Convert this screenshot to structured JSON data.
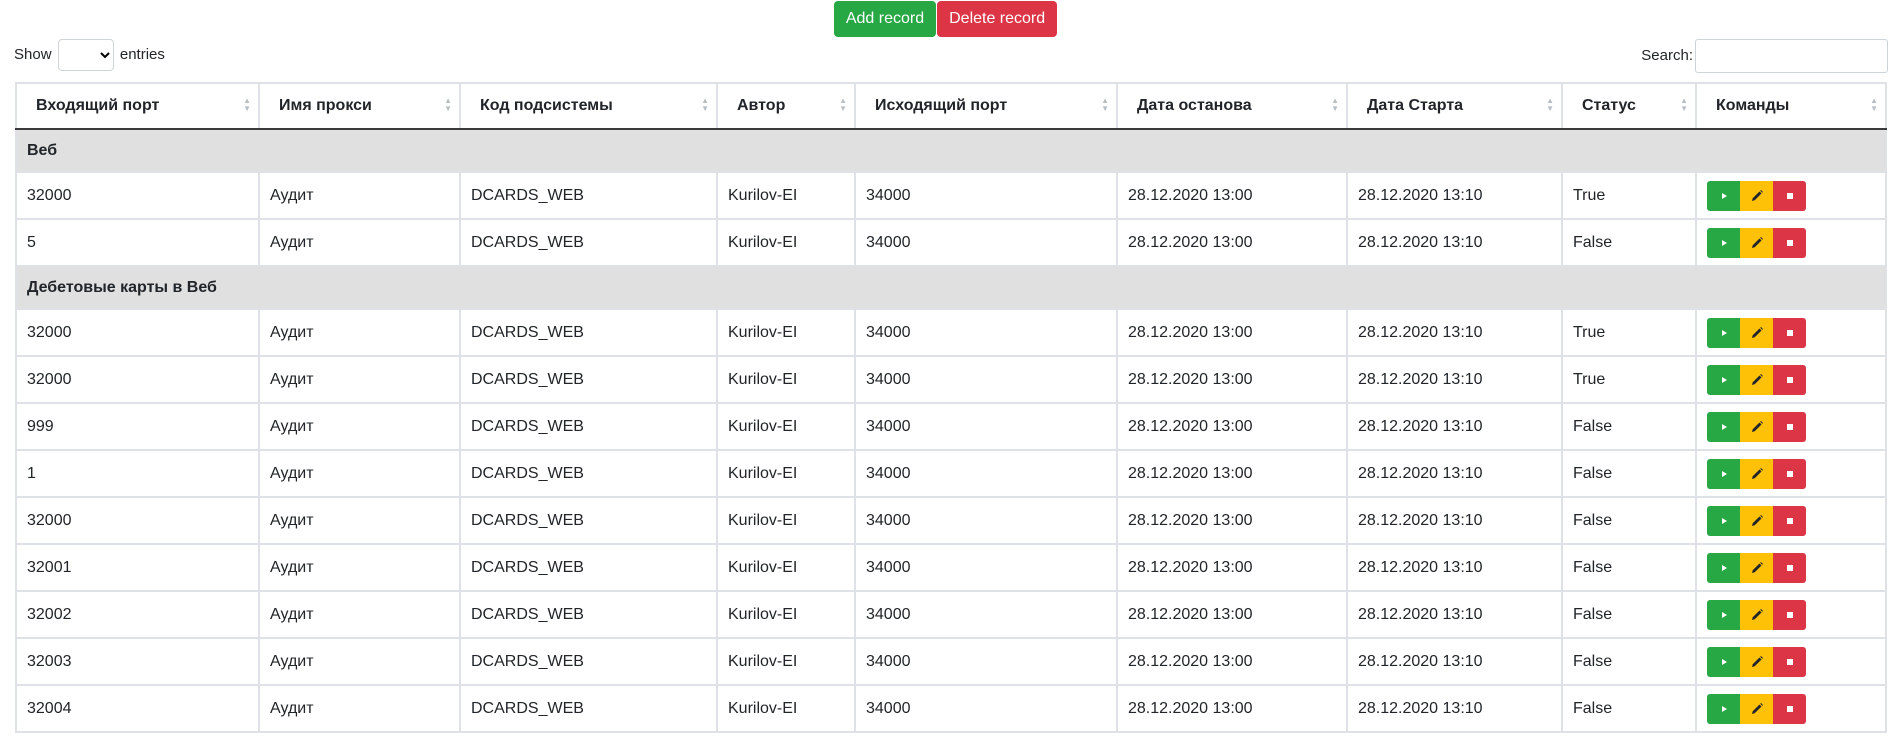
{
  "toolbar": {
    "add_label": "Add record",
    "delete_label": "Delete record"
  },
  "length": {
    "show": "Show",
    "entries": "entries",
    "value": ""
  },
  "search": {
    "label": "Search:",
    "value": ""
  },
  "columns": [
    "Входящий порт",
    "Имя прокси",
    "Код подсистемы",
    "Автор",
    "Исходящий порт",
    "Дата останова",
    "Дата Старта",
    "Статус",
    "Команды"
  ],
  "groups": [
    {
      "name": "Веб",
      "rows": [
        [
          "32000",
          "Аудит",
          "DCARDS_WEB",
          "Kurilov-EI",
          "34000",
          "28.12.2020 13:00",
          "28.12.2020 13:10",
          "True"
        ],
        [
          "5",
          "Аудит",
          "DCARDS_WEB",
          "Kurilov-EI",
          "34000",
          "28.12.2020 13:00",
          "28.12.2020 13:10",
          "False"
        ]
      ]
    },
    {
      "name": "Дебетовые карты в Веб",
      "rows": [
        [
          "32000",
          "Аудит",
          "DCARDS_WEB",
          "Kurilov-EI",
          "34000",
          "28.12.2020 13:00",
          "28.12.2020 13:10",
          "True"
        ],
        [
          "32000",
          "Аудит",
          "DCARDS_WEB",
          "Kurilov-EI",
          "34000",
          "28.12.2020 13:00",
          "28.12.2020 13:10",
          "True"
        ],
        [
          "999",
          "Аудит",
          "DCARDS_WEB",
          "Kurilov-EI",
          "34000",
          "28.12.2020 13:00",
          "28.12.2020 13:10",
          "False"
        ],
        [
          "1",
          "Аудит",
          "DCARDS_WEB",
          "Kurilov-EI",
          "34000",
          "28.12.2020 13:00",
          "28.12.2020 13:10",
          "False"
        ],
        [
          "32000",
          "Аудит",
          "DCARDS_WEB",
          "Kurilov-EI",
          "34000",
          "28.12.2020 13:00",
          "28.12.2020 13:10",
          "False"
        ],
        [
          "32001",
          "Аудит",
          "DCARDS_WEB",
          "Kurilov-EI",
          "34000",
          "28.12.2020 13:00",
          "28.12.2020 13:10",
          "False"
        ],
        [
          "32002",
          "Аудит",
          "DCARDS_WEB",
          "Kurilov-EI",
          "34000",
          "28.12.2020 13:00",
          "28.12.2020 13:10",
          "False"
        ],
        [
          "32003",
          "Аудит",
          "DCARDS_WEB",
          "Kurilov-EI",
          "34000",
          "28.12.2020 13:00",
          "28.12.2020 13:10",
          "False"
        ],
        [
          "32004",
          "Аудит",
          "DCARDS_WEB",
          "Kurilov-EI",
          "34000",
          "28.12.2020 13:00",
          "28.12.2020 13:10",
          "False"
        ]
      ]
    }
  ],
  "commands": [
    {
      "name": "start-icon",
      "color": "#28a745"
    },
    {
      "name": "edit-pencil-icon",
      "color": "#ffc107"
    },
    {
      "name": "stop-icon",
      "color": "#dc3545"
    }
  ],
  "colors": {
    "add": "#28a745",
    "delete": "#dc3545",
    "group_bg": "#e0e0e0"
  }
}
